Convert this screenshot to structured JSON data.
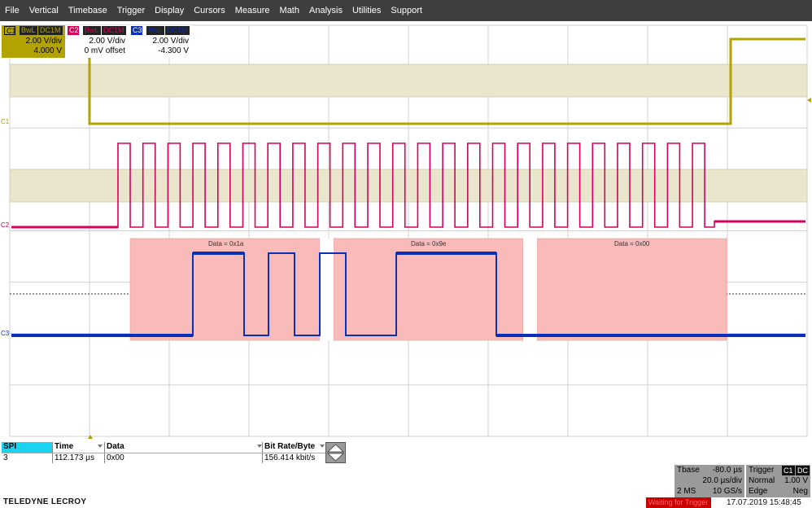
{
  "menu": [
    "File",
    "Vertical",
    "Timebase",
    "Trigger",
    "Display",
    "Cursors",
    "Measure",
    "Math",
    "Analysis",
    "Utilities",
    "Support"
  ],
  "channel_labels": {
    "c1": "C1",
    "c2": "C2",
    "c3": "C3"
  },
  "decode_labels": [
    "Data = 0x1a",
    "Data = 0x9e",
    "Data = 0x00"
  ],
  "table": {
    "headers": [
      "SPI",
      "Time",
      "Data",
      "Bit Rate/Byte"
    ],
    "row": [
      "3",
      "112.173 µs",
      "0x00",
      "156.414 kbit/s"
    ]
  },
  "channels": [
    {
      "tag1": "BwL",
      "tag2": "DC1M",
      "scale": "2.00 V/div",
      "offset": "4.000 V",
      "color": "#b3a300"
    },
    {
      "tag1": "BwL",
      "tag2": "DC1M",
      "scale": "2.00 V/div",
      "offset": "0 mV offset",
      "color": "#d8005a"
    },
    {
      "tag1": "BwL",
      "tag2": "DC1M",
      "scale": "2.00 V/div",
      "offset": "-4.300 V",
      "color": "#0a2fb8"
    }
  ],
  "timebase": {
    "label": "Tbase",
    "delay": "-80.0 µs",
    "per_div": "20.0 µs/div",
    "samples": "2 MS",
    "rate": "10 GS/s"
  },
  "trigger": {
    "label": "Trigger",
    "source": "C1",
    "coupling": "DC",
    "mode": "Normal",
    "level": "1.00 V",
    "type": "Edge",
    "slope": "Neg"
  },
  "status": "Waiting for Trigger",
  "timestamp": "17.07.2019 15:48:45",
  "brand": "TELEDYNE LECROY",
  "colors": {
    "c1": "#b3a300",
    "c2": "#d8005a",
    "c3": "#0a2fb8",
    "decode": "#f9baba",
    "menubar": "#3e3e3e"
  }
}
